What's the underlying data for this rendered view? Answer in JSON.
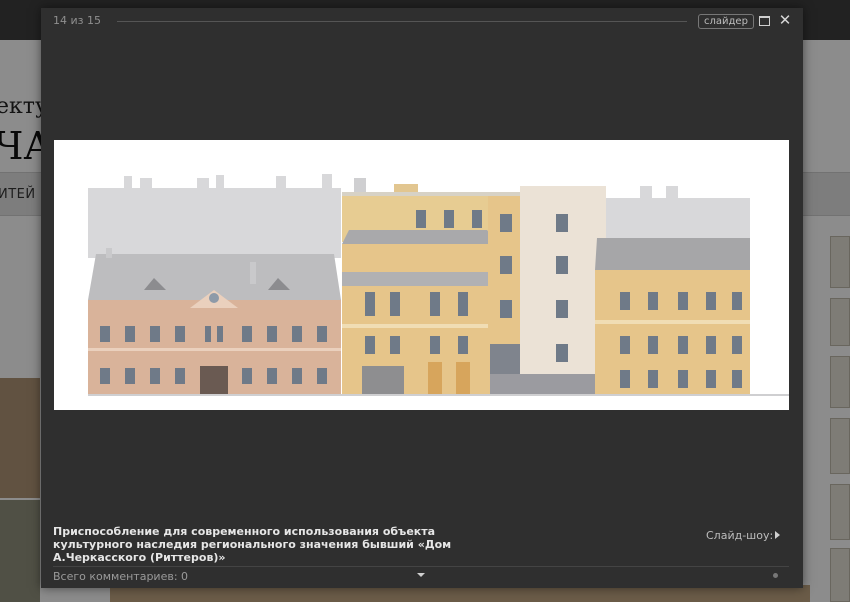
{
  "background": {
    "title_fragment": "ектур",
    "title_big_fragment": "ЧА",
    "nav_fragment": "ИТЕЙ"
  },
  "lightbox": {
    "counter": "14 из 15",
    "slider_label": "слайдер",
    "caption": "Приспособление для современного использования объекта культурного наследия регионального значения бывший «Дом А.Черкасского (Риттеров)»",
    "slideshow_label": "Слайд-шоу:",
    "comments_label": "Всего комментариев: 0",
    "icons": [
      "fullscreen-icon",
      "close-icon",
      "play-icon",
      "chevron-down-icon"
    ],
    "colors": {
      "panel": "#2f2f2f",
      "text_light": "#e6e6e6",
      "text_muted": "#9a9a9a"
    }
  }
}
